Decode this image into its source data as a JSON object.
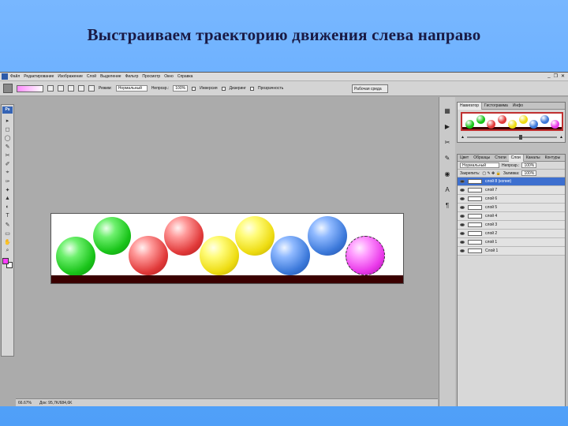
{
  "slide": {
    "title": "Выстраиваем траекторию движения слева направо"
  },
  "menubar": {
    "items": [
      "Файл",
      "Редактирование",
      "Изображение",
      "Слой",
      "Выделение",
      "Фильтр",
      "Просмотр",
      "Окно",
      "Справка"
    ],
    "controls": [
      "_",
      "❐",
      "✕"
    ]
  },
  "options": {
    "mode_label": "Режим:",
    "mode_value": "Нормальный",
    "opacity_label": "Непрозр.:",
    "opacity_value": "100%",
    "inverse_label": "Инверсия",
    "dither_label": "Дизеринг",
    "transparency_label": "Прозрачность",
    "workspace_label": "Рабочая среда"
  },
  "tools": [
    "▸",
    "◻",
    "◯",
    "✎",
    "✂",
    "✐",
    "⌖",
    "✑",
    "✦",
    "▲",
    "◐",
    "T",
    "✎",
    "▭",
    "✋",
    "⌕"
  ],
  "colors": {
    "foreground": "#ff3dff",
    "background": "#ffffff"
  },
  "statusbar": {
    "zoom": "66.67%",
    "doc": "Док: 95,7K/684,6K"
  },
  "navigator": {
    "tabs": [
      "Навигатор",
      "Гистограмма",
      "Инфо"
    ],
    "balls": [
      "#19c419",
      "#19c419",
      "#e13a3a",
      "#e13a3a",
      "#eedc12",
      "#eedc12",
      "#3c79da",
      "#3c79da",
      "#ea3aea"
    ]
  },
  "layers": {
    "tabs": [
      "Цвет",
      "Образцы",
      "Стили",
      "Слои",
      "Каналы",
      "Контуры"
    ],
    "blend_value": "Нормальный",
    "opacity_label": "Непрозр.:",
    "opacity_value": "100%",
    "lock_label": "Закрепить:",
    "fill_label": "Заливка:",
    "fill_value": "100%",
    "items": [
      {
        "name": "слой 8 (копия)",
        "selected": true
      },
      {
        "name": "слой 7",
        "selected": false
      },
      {
        "name": "слой 6",
        "selected": false
      },
      {
        "name": "слой 5",
        "selected": false
      },
      {
        "name": "слой 4",
        "selected": false
      },
      {
        "name": "слой 3",
        "selected": false
      },
      {
        "name": "слой 2",
        "selected": false
      },
      {
        "name": "слой 1",
        "selected": false
      },
      {
        "name": "Слой 1",
        "selected": false
      }
    ],
    "bottom_icons": [
      "⛓",
      "fx",
      "◑",
      "◐",
      "▭",
      "⊞",
      "🗑"
    ]
  }
}
